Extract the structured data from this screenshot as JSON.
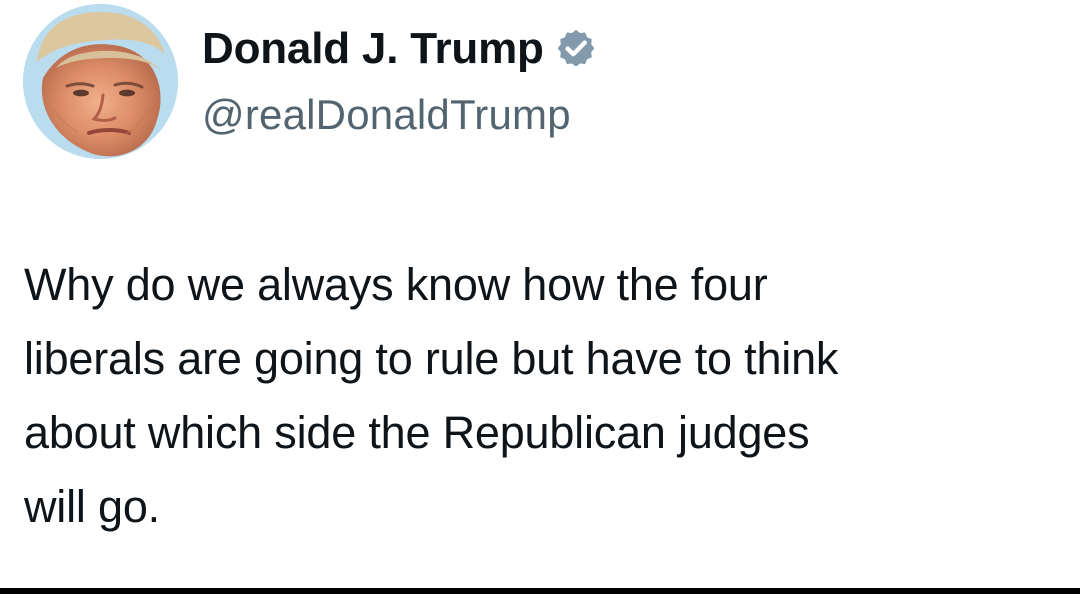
{
  "author": {
    "display_name": "Donald J. Trump",
    "handle": "@realDonaldTrump",
    "verified": true
  },
  "tweet": {
    "lines": [
      "Why do we always know how the four",
      "liberals are going to rule but have to think",
      "about which side the Republican judges",
      "will go."
    ]
  },
  "colors": {
    "background": "#ffffff",
    "text": "#0f1419",
    "handle_gray": "#536471",
    "verified_badge": "#829aab",
    "avatar_background": "#b9dcef"
  },
  "icons": {
    "verified_badge": "verified-badge-icon"
  }
}
